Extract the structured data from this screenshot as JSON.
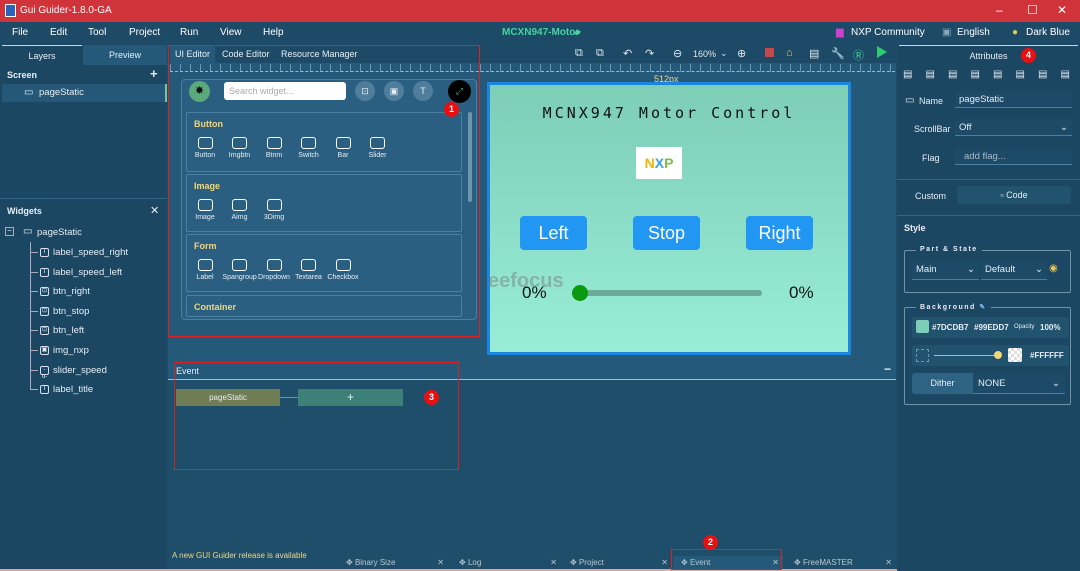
{
  "title": "Gui Guider-1.8.0-GA",
  "menu": [
    "File",
    "Edit",
    "Tool",
    "Project",
    "Run",
    "View",
    "Help"
  ],
  "project_name": "MCXN947-Motor",
  "top_right": {
    "community": "NXP Community",
    "language": "English",
    "theme": "Dark Blue"
  },
  "left": {
    "tabs": [
      "Layers",
      "Preview"
    ],
    "screen_label": "Screen",
    "screens": [
      "pageStatic"
    ],
    "widgets_label": "Widgets",
    "root": "pageStatic",
    "widgets": [
      {
        "name": "label_speed_right",
        "icon": "label-icon"
      },
      {
        "name": "label_speed_left",
        "icon": "label-icon"
      },
      {
        "name": "btn_right",
        "icon": "button-icon"
      },
      {
        "name": "btn_stop",
        "icon": "button-icon"
      },
      {
        "name": "btn_left",
        "icon": "button-icon"
      },
      {
        "name": "img_nxp",
        "icon": "image-icon"
      },
      {
        "name": "slider_speed",
        "icon": "slider-icon"
      },
      {
        "name": "label_title",
        "icon": "label-icon"
      }
    ]
  },
  "editor_tabs": [
    "UI Editor",
    "Code Editor",
    "Resource Manager"
  ],
  "zoom": "160%",
  "palette": {
    "search_placeholder": "Search widget...",
    "groups": [
      {
        "name": "Button",
        "items": [
          "Button",
          "Imgbtn",
          "Btnm",
          "Switch",
          "Bar",
          "Slider"
        ]
      },
      {
        "name": "Image",
        "items": [
          "Image",
          "Aimg",
          "3Dimg"
        ]
      },
      {
        "name": "Form",
        "items": [
          "Label",
          "Spangroup",
          "Dropdown",
          "Textarea",
          "Checkbox"
        ]
      },
      {
        "name": "Container",
        "items": []
      }
    ]
  },
  "canvas": {
    "width_label": "512px",
    "title": "MCNX947 Motor Control",
    "logo": "NXP",
    "buttons": [
      "Left",
      "Stop",
      "Right"
    ],
    "speed_left": "0%",
    "speed_right": "0%",
    "slider_value": 0,
    "watermark": "eefocus"
  },
  "event": {
    "header": "Event",
    "node": "pageStatic",
    "add": "+"
  },
  "bottom": {
    "notice": "A new GUI Guider release is available",
    "tabs": [
      "Binary Size",
      "Log",
      "Project",
      "Event",
      "FreeMASTER"
    ]
  },
  "attributes": {
    "title": "Attributes",
    "name_label": "Name",
    "name_value": "pageStatic",
    "scrollbar_label": "ScrollBar",
    "scrollbar_value": "Off",
    "flag_label": "Flag",
    "flag_placeholder": "add flag...",
    "custom_label": "Custom",
    "code_button": "Code",
    "style_label": "Style",
    "part_state_label": "Part & State",
    "part": "Main",
    "state": "Default",
    "background_label": "Background",
    "color1": "#7DCDB7",
    "color2": "#99EDD7",
    "opacity_label": "Opacity",
    "opacity": "100%",
    "image_color": "#FFFFFF",
    "dither_label": "Dither",
    "dither_value": "NONE"
  },
  "badges": [
    "1",
    "2",
    "3",
    "4"
  ],
  "colors": {
    "titlebar": "#d0343a",
    "accent": "#2196f3",
    "bg_start": "#7DCDB7",
    "bg_end": "#99EDD7"
  }
}
